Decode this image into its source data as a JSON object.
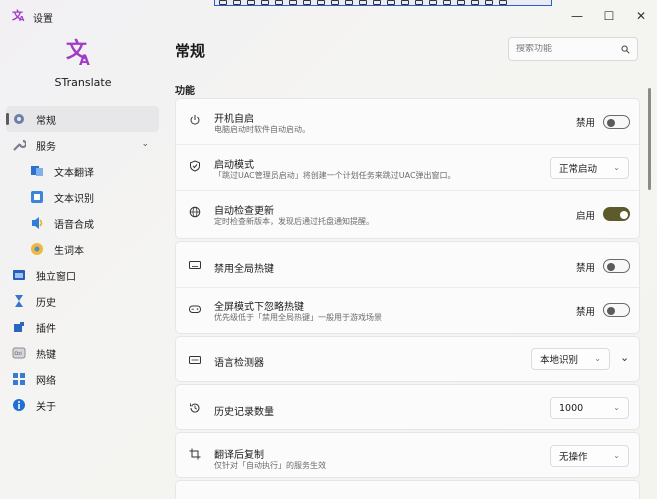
{
  "window": {
    "title": "设置",
    "controls": {
      "minimize": "—",
      "maximize": "☐",
      "close": "✕"
    }
  },
  "sidebar": {
    "app_name": "STranslate",
    "items": [
      {
        "label": "常规",
        "icon": "settings-gear-icon",
        "active": true
      },
      {
        "label": "服务",
        "icon": "wrench-icon",
        "expandable": true
      },
      {
        "label": "文本翻译",
        "icon": "translate-icon",
        "sub": true
      },
      {
        "label": "文本识别",
        "icon": "ocr-icon",
        "sub": true
      },
      {
        "label": "语音合成",
        "icon": "speaker-icon",
        "sub": true
      },
      {
        "label": "生词本",
        "icon": "notebook-icon",
        "sub": true
      },
      {
        "label": "独立窗口",
        "icon": "window-icon"
      },
      {
        "label": "历史",
        "icon": "hourglass-icon"
      },
      {
        "label": "插件",
        "icon": "plugin-icon"
      },
      {
        "label": "热键",
        "icon": "ctrl-key-icon"
      },
      {
        "label": "网络",
        "icon": "network-icon"
      },
      {
        "label": "关于",
        "icon": "info-icon"
      }
    ]
  },
  "main": {
    "title": "常规",
    "search_placeholder": "搜索功能",
    "section_title": "功能",
    "rows": {
      "startup": {
        "title": "开机自启",
        "desc": "电脑启动时软件自动启动。",
        "toggle_label": "禁用",
        "on": false
      },
      "start_mode": {
        "title": "启动模式",
        "desc": "「跳过UAC管理员启动」将创建一个计划任务来跳过UAC弹出窗口。",
        "value": "正常启动"
      },
      "auto_update": {
        "title": "自动检查更新",
        "desc": "定时检查新版本，发现后通过托盘通知提醒。",
        "toggle_label": "启用",
        "on": true
      },
      "disable_hotkey": {
        "title": "禁用全局热键",
        "toggle_label": "禁用",
        "on": false
      },
      "fullscreen_hotkey": {
        "title": "全屏模式下忽略热键",
        "desc": "优先级低于「禁用全局热键」一般用于游戏场景",
        "toggle_label": "禁用",
        "on": false
      },
      "lang_detector": {
        "title": "语言检测器",
        "value": "本地识别"
      },
      "history_count": {
        "title": "历史记录数量",
        "value": "1000"
      },
      "copy_after": {
        "title": "翻译后复制",
        "desc": "仅针对「自动执行」的服务生效",
        "value": "无操作"
      }
    }
  },
  "colors": {
    "toggle_on": "#5d5a2b",
    "logo": "#a03cc8"
  }
}
